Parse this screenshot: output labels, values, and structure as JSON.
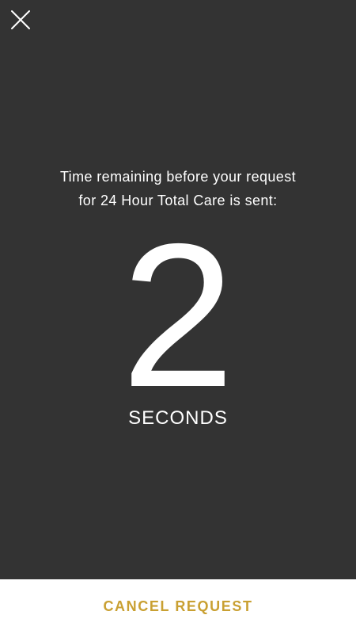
{
  "header": {
    "close_icon": "close-icon"
  },
  "message": {
    "line1": "Time remaining before your request",
    "line2": "for 24 Hour Total Care is sent:"
  },
  "countdown": {
    "value": "2",
    "unit": "SECONDS"
  },
  "footer": {
    "cancel_label": "CANCEL REQUEST"
  },
  "colors": {
    "background": "#333333",
    "text": "#ffffff",
    "accent": "#c9a032",
    "footer_background": "#ffffff"
  }
}
